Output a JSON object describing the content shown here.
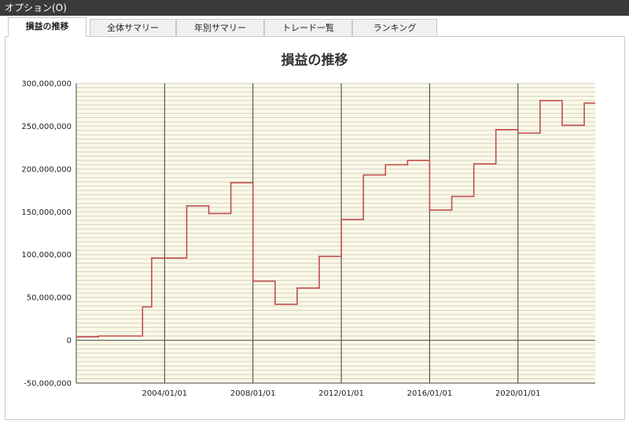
{
  "menubar": {
    "title": "オプション(O)"
  },
  "tabs": [
    {
      "label": "損益の推移",
      "active": true
    },
    {
      "label": "全体サマリー",
      "active": false
    },
    {
      "label": "年別サマリー",
      "active": false
    },
    {
      "label": "トレード一覧",
      "active": false
    },
    {
      "label": "ランキング",
      "active": false
    }
  ],
  "colors": {
    "plot_background": "#fbf9e6",
    "line": "#c0504d",
    "grid_minor": "#d2d2cc",
    "grid_major": "#3a3a3a"
  },
  "chart_data": {
    "type": "line",
    "title": "損益の推移",
    "xlabel": "",
    "ylabel": "",
    "step": true,
    "grid": true,
    "ylim": [
      -50000000,
      300000000
    ],
    "xlim": [
      "2000/01/01",
      "2023/07/01"
    ],
    "yticks": [
      300000000,
      250000000,
      200000000,
      150000000,
      100000000,
      50000000,
      0,
      -50000000
    ],
    "ytick_labels": [
      "300,000,000",
      "250,000,000",
      "200,000,000",
      "150,000,000",
      "100,000,000",
      "50,000,000",
      "0",
      "-50,000,000"
    ],
    "xticks": [
      "2004/01/01",
      "2008/01/01",
      "2012/01/01",
      "2016/01/01",
      "2020/01/01"
    ],
    "series": [
      {
        "x": [
          "2000/01/01",
          "2001/01/01",
          "2002/01/01",
          "2003/01/01",
          "2003/06/01",
          "2005/01/01",
          "2006/01/01",
          "2007/01/01",
          "2008/01/01",
          "2009/01/01",
          "2010/01/01",
          "2011/01/01",
          "2012/01/01",
          "2013/01/01",
          "2014/01/01",
          "2015/01/01",
          "2016/01/01",
          "2017/01/01",
          "2018/01/01",
          "2019/01/01",
          "2020/01/01",
          "2021/01/01",
          "2022/01/01",
          "2023/01/01"
        ],
        "y": [
          4000000,
          5000000,
          5000000,
          39000000,
          96000000,
          157000000,
          148000000,
          184000000,
          69000000,
          42000000,
          61000000,
          98000000,
          141000000,
          193000000,
          205000000,
          210000000,
          152000000,
          168000000,
          206000000,
          246000000,
          242000000,
          280000000,
          251000000,
          277000000
        ]
      }
    ]
  }
}
